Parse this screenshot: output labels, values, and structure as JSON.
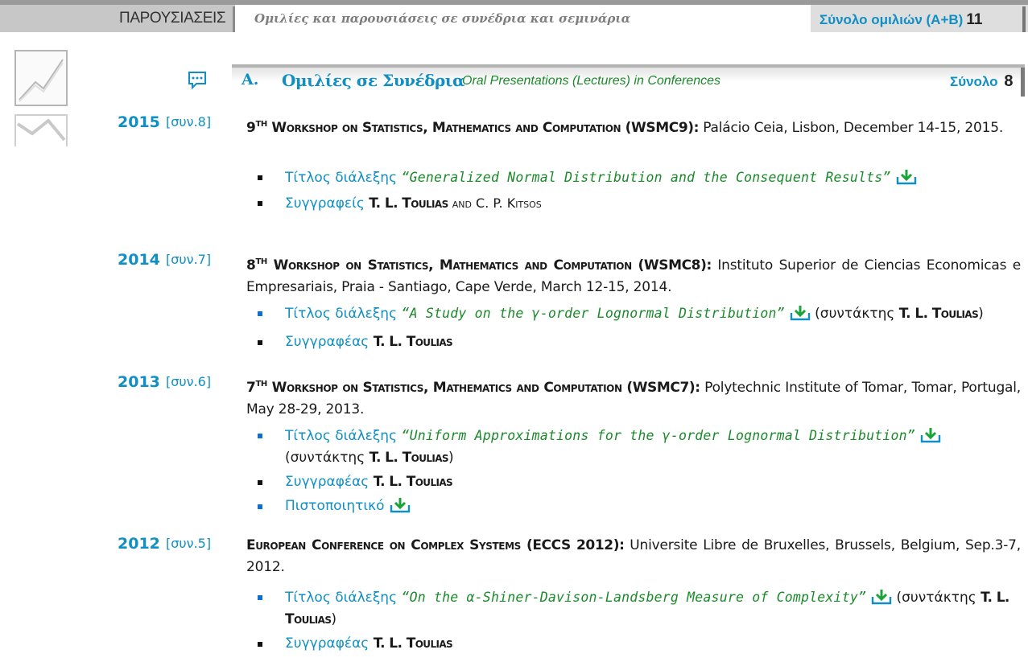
{
  "header": {
    "section_label": "ΠΑΡΟΥΣΙΑΣΕΙΣ",
    "subtitle": "Ομιλίες και παρουσιάσεις σε συνέδρια και σεμινάρια",
    "total_label": "Σύνολο ομιλιών (Α+Β)",
    "total_value": "11"
  },
  "section": {
    "letter": "Α.",
    "title": "Ομιλίες σε Συνέδρια",
    "title_en": "Oral Presentations (Lectures) in Conferences",
    "total_label": "Σύνολο",
    "total_value": "8"
  },
  "entries": [
    {
      "year": "2015",
      "code": "[συν.8]",
      "event_ord": "9",
      "event_sup": "TH",
      "event_name": "Workshop on Statistics, Mathematics and Computation (WSMC9):",
      "event_place": " Palácio Ceia, Lisbon, December 14-15, 2015.",
      "title_label": "Τίτλος διάλεξης",
      "title": "“Generalized Normal Distribution and the Consequent Results”",
      "authors_label": "Συγγραφείς",
      "author_main": "T. L. Toulias",
      "author_rest": " and C. P. Kitsos"
    },
    {
      "year": "2014",
      "code": "[συν.7]",
      "event_ord": "8",
      "event_sup": "TH",
      "event_name": "Workshop on Statistics, Mathematics and Computation (WSMC8):",
      "event_place": " Instituto Superior de Ciencias Economicas e Empresariais, Praia - Santiago, Cape Verde, March 12-15, 2014.",
      "title_label": "Τίτλος διάλεξης",
      "title": "“A Study on the γ-order Lognormal Distribution”",
      "editor_prefix": "(συντάκτης ",
      "editor": "T. L. Toulias",
      "editor_suffix": ")",
      "authors_label": "Συγγραφέας",
      "author_main": "T. L. Toulias"
    },
    {
      "year": "2013",
      "code": "[συν.6]",
      "event_ord": "7",
      "event_sup": "TH",
      "event_name": "Workshop on Statistics, Mathematics and Computation (WSMC7):",
      "event_place": " Polytechnic Institute of Tomar, Tomar, Portugal, May 28-29, 2013.",
      "title_label": "Τίτλος διάλεξης",
      "title": "“Uniform Approximations for the γ-order Lognormal Distribution”",
      "editor_prefix": "(συντάκτης ",
      "editor": "T. L. Toulias",
      "editor_suffix": ")",
      "authors_label": "Συγγραφέας",
      "author_main": "T. L. Toulias",
      "certificate_label": "Πιστοποιητικό"
    },
    {
      "year": "2012",
      "code": "[συν.5]",
      "event_name": "European Conference on Complex Systems (ECCS 2012):",
      "event_place": " Universite Libre de Bruxelles, Brussels, Belgium, Sep.3-7, 2012.",
      "title_label": "Τίτλος διάλεξης",
      "title": "“On the α-Shiner-Davison-Landsberg Measure of Complexity”",
      "editor_prefix": "(συντάκτης ",
      "editor": "T. L. Toulias",
      "editor_suffix": ")",
      "authors_label": "Συγγραφέας",
      "author_main": "T. L. Toulias"
    }
  ],
  "colors": {
    "accent_blue": "#0f8fc4",
    "title_green": "#1a8a2a"
  }
}
